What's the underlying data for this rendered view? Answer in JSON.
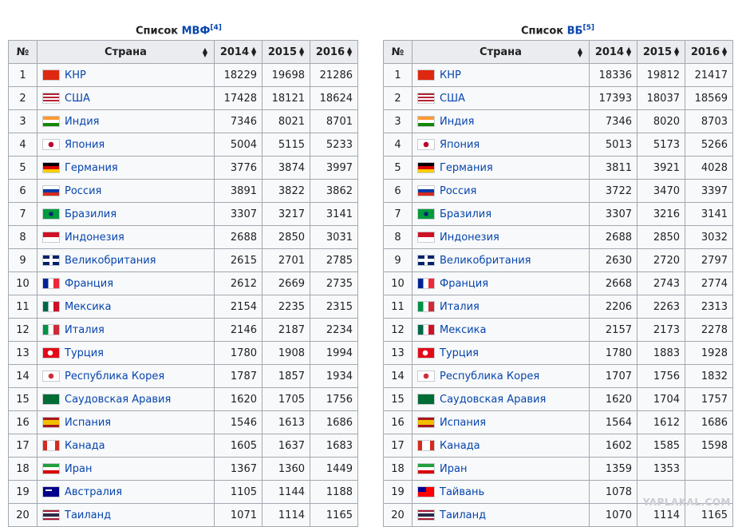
{
  "tables": [
    {
      "caption_prefix": "Список",
      "caption_link": "МВФ",
      "caption_ref": "[4]",
      "headers": [
        "№",
        "Страна",
        "2014",
        "2015",
        "2016"
      ],
      "rows": [
        {
          "n": "1",
          "country": "КНР",
          "flag": "cn",
          "v": [
            "18229",
            "19698",
            "21286"
          ]
        },
        {
          "n": "2",
          "country": "США",
          "flag": "us",
          "v": [
            "17428",
            "18121",
            "18624"
          ]
        },
        {
          "n": "3",
          "country": "Индия",
          "flag": "in",
          "v": [
            "7346",
            "8021",
            "8701"
          ]
        },
        {
          "n": "4",
          "country": "Япония",
          "flag": "jp",
          "v": [
            "5004",
            "5115",
            "5233"
          ]
        },
        {
          "n": "5",
          "country": "Германия",
          "flag": "de",
          "v": [
            "3776",
            "3874",
            "3997"
          ]
        },
        {
          "n": "6",
          "country": "Россия",
          "flag": "ru",
          "v": [
            "3891",
            "3822",
            "3862"
          ]
        },
        {
          "n": "7",
          "country": "Бразилия",
          "flag": "br",
          "v": [
            "3307",
            "3217",
            "3141"
          ]
        },
        {
          "n": "8",
          "country": "Индонезия",
          "flag": "id",
          "v": [
            "2688",
            "2850",
            "3031"
          ]
        },
        {
          "n": "9",
          "country": "Великобритания",
          "flag": "gb",
          "v": [
            "2615",
            "2701",
            "2785"
          ]
        },
        {
          "n": "10",
          "country": "Франция",
          "flag": "fr",
          "v": [
            "2612",
            "2669",
            "2735"
          ]
        },
        {
          "n": "11",
          "country": "Мексика",
          "flag": "mx",
          "v": [
            "2154",
            "2235",
            "2315"
          ]
        },
        {
          "n": "12",
          "country": "Италия",
          "flag": "it",
          "v": [
            "2146",
            "2187",
            "2234"
          ]
        },
        {
          "n": "13",
          "country": "Турция",
          "flag": "tr",
          "v": [
            "1780",
            "1908",
            "1994"
          ]
        },
        {
          "n": "14",
          "country": "Республика Корея",
          "flag": "kr",
          "v": [
            "1787",
            "1857",
            "1934"
          ]
        },
        {
          "n": "15",
          "country": "Саудовская Аравия",
          "flag": "sa",
          "v": [
            "1620",
            "1705",
            "1756"
          ]
        },
        {
          "n": "16",
          "country": "Испания",
          "flag": "es",
          "v": [
            "1546",
            "1613",
            "1686"
          ]
        },
        {
          "n": "17",
          "country": "Канада",
          "flag": "ca",
          "v": [
            "1605",
            "1637",
            "1683"
          ]
        },
        {
          "n": "18",
          "country": "Иран",
          "flag": "ir",
          "v": [
            "1367",
            "1360",
            "1449"
          ]
        },
        {
          "n": "19",
          "country": "Австралия",
          "flag": "au",
          "v": [
            "1105",
            "1144",
            "1188"
          ]
        },
        {
          "n": "20",
          "country": "Таиланд",
          "flag": "th",
          "v": [
            "1071",
            "1114",
            "1165"
          ]
        }
      ]
    },
    {
      "caption_prefix": "Список",
      "caption_link": "ВБ",
      "caption_ref": "[5]",
      "headers": [
        "№",
        "Страна",
        "2014",
        "2015",
        "2016"
      ],
      "rows": [
        {
          "n": "1",
          "country": "КНР",
          "flag": "cn",
          "v": [
            "18336",
            "19812",
            "21417"
          ]
        },
        {
          "n": "2",
          "country": "США",
          "flag": "us",
          "v": [
            "17393",
            "18037",
            "18569"
          ]
        },
        {
          "n": "3",
          "country": "Индия",
          "flag": "in",
          "v": [
            "7346",
            "8020",
            "8703"
          ]
        },
        {
          "n": "4",
          "country": "Япония",
          "flag": "jp",
          "v": [
            "5013",
            "5173",
            "5266"
          ]
        },
        {
          "n": "5",
          "country": "Германия",
          "flag": "de",
          "v": [
            "3811",
            "3921",
            "4028"
          ]
        },
        {
          "n": "6",
          "country": "Россия",
          "flag": "ru",
          "v": [
            "3722",
            "3470",
            "3397"
          ]
        },
        {
          "n": "7",
          "country": "Бразилия",
          "flag": "br",
          "v": [
            "3307",
            "3216",
            "3141"
          ]
        },
        {
          "n": "8",
          "country": "Индонезия",
          "flag": "id",
          "v": [
            "2688",
            "2850",
            "3032"
          ]
        },
        {
          "n": "9",
          "country": "Великобритания",
          "flag": "gb",
          "v": [
            "2630",
            "2720",
            "2797"
          ]
        },
        {
          "n": "10",
          "country": "Франция",
          "flag": "fr",
          "v": [
            "2668",
            "2743",
            "2774"
          ]
        },
        {
          "n": "11",
          "country": "Италия",
          "flag": "it",
          "v": [
            "2206",
            "2263",
            "2313"
          ]
        },
        {
          "n": "12",
          "country": "Мексика",
          "flag": "mx",
          "v": [
            "2157",
            "2173",
            "2278"
          ]
        },
        {
          "n": "13",
          "country": "Турция",
          "flag": "tr",
          "v": [
            "1780",
            "1883",
            "1928"
          ]
        },
        {
          "n": "14",
          "country": "Республика Корея",
          "flag": "kr",
          "v": [
            "1707",
            "1756",
            "1832"
          ]
        },
        {
          "n": "15",
          "country": "Саудовская Аравия",
          "flag": "sa",
          "v": [
            "1620",
            "1704",
            "1757"
          ]
        },
        {
          "n": "16",
          "country": "Испания",
          "flag": "es",
          "v": [
            "1564",
            "1612",
            "1686"
          ]
        },
        {
          "n": "17",
          "country": "Канада",
          "flag": "ca",
          "v": [
            "1602",
            "1585",
            "1598"
          ]
        },
        {
          "n": "18",
          "country": "Иран",
          "flag": "ir",
          "v": [
            "1359",
            "1353",
            ""
          ]
        },
        {
          "n": "19",
          "country": "Тайвань",
          "flag": "tw",
          "v": [
            "1078",
            "",
            ""
          ]
        },
        {
          "n": "20",
          "country": "Таиланд",
          "flag": "th",
          "v": [
            "1070",
            "1114",
            "1165"
          ]
        }
      ]
    }
  ],
  "watermark": "YAPLAKAL.COM",
  "colors": {
    "link": "#0645ad",
    "header_bg": "#eaecf0",
    "cell_bg": "#f8f9fa",
    "border": "#a2a9b1"
  }
}
